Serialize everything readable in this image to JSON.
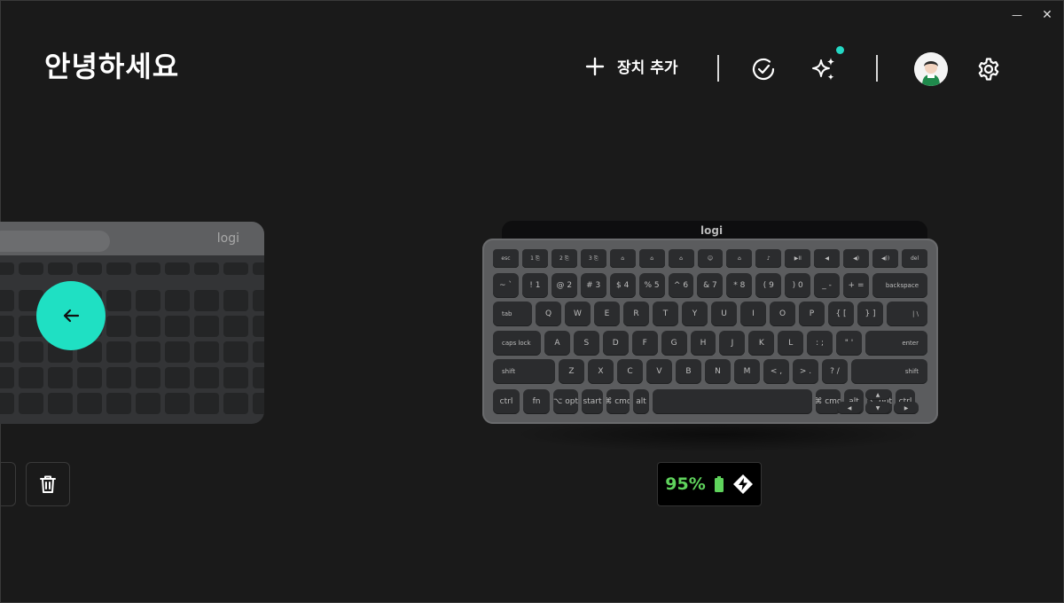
{
  "header": {
    "greeting": "안녕하세요",
    "add_device_label": "장치 추가"
  },
  "window": {
    "minimize_glyph": "—",
    "close_glyph": "✕"
  },
  "icons": {
    "add": "plus-icon",
    "updates": "check-circle-icon",
    "ai": "sparkles-icon",
    "settings": "gear-icon",
    "back": "arrow-left-icon",
    "delete": "trash-icon",
    "battery": "battery-icon",
    "connection": "logi-bolt-icon"
  },
  "colors": {
    "accent": "#1fe0c3",
    "battery_ok": "#5fd35c",
    "notification": "#24d8c4"
  },
  "previous_device": {
    "logo": "logi"
  },
  "current_device": {
    "logo": "logi",
    "battery_percent": "95%",
    "key_rows": [
      [
        "esc",
        "1 ⎘",
        "2 ⎘",
        "3 ⎘",
        "⌂",
        "⌂",
        "⌂",
        "☺",
        "⌂",
        "♪",
        "▶II",
        "◀",
        "◀)",
        "◀))",
        "del"
      ],
      [
        "~ `",
        "! 1",
        "@ 2",
        "# 3",
        "$ 4",
        "% 5",
        "^ 6",
        "& 7",
        "* 8",
        "( 9",
        ") 0",
        "_ -",
        "+ =",
        "backspace"
      ],
      [
        "tab",
        "Q",
        "W",
        "E",
        "R",
        "T",
        "Y",
        "U",
        "I",
        "O",
        "P",
        "{ [",
        "} ]",
        "| \\"
      ],
      [
        "caps lock",
        "A",
        "S",
        "D",
        "F",
        "G",
        "H",
        "J",
        "K",
        "L",
        ": ;",
        "\" '",
        "enter"
      ],
      [
        "shift",
        "Z",
        "X",
        "C",
        "V",
        "B",
        "N",
        "M",
        "< ,",
        "> .",
        "? /",
        "shift"
      ],
      [
        "ctrl",
        "fn",
        "⌥ opt",
        "start",
        "⌘ cmd",
        "alt",
        "",
        "⌘ cmd",
        "alt",
        "⌥ opt",
        "ctrl",
        "◀",
        "▲",
        "▼",
        "▶"
      ]
    ]
  }
}
